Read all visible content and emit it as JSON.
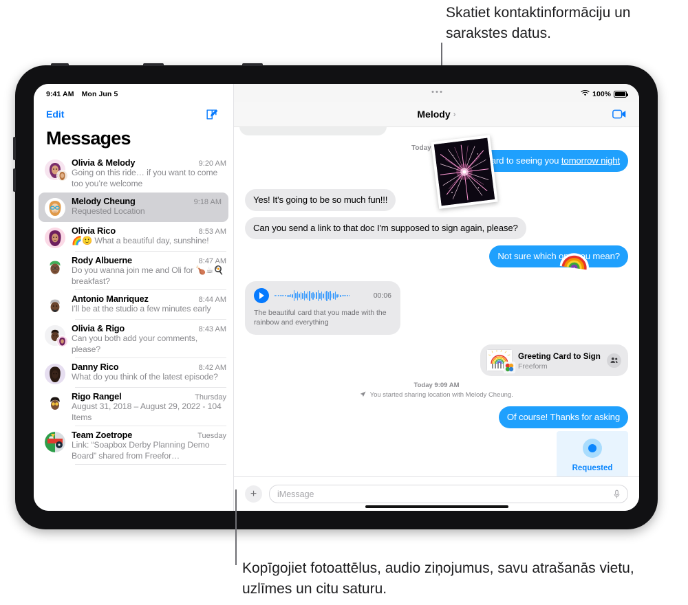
{
  "callouts": {
    "top": "Skatiet kontaktinformāciju un sarakstes datus.",
    "bottom": "Kopīgojiet fotoattēlus, audio ziņojumus, savu atrašanās vietu, uzlīmes un citu saturu."
  },
  "status_bar": {
    "time": "9:41 AM",
    "date": "Mon Jun 5",
    "battery_percent": "100%",
    "wifi_icon": "wifi-icon",
    "battery_icon": "battery-icon"
  },
  "sidebar": {
    "edit_label": "Edit",
    "compose_icon": "compose-icon",
    "title": "Messages",
    "conversations": [
      {
        "name": "Olivia & Melody",
        "time": "9:20 AM",
        "preview": "Going on this ride… if you want to come too you’re welcome",
        "selected": false,
        "avatar": "group-avatar-olivia-melody"
      },
      {
        "name": "Melody Cheung",
        "time": "9:18 AM",
        "preview": "Requested Location",
        "selected": true,
        "avatar": "avatar-melody-cheung"
      },
      {
        "name": "Olivia Rico",
        "time": "8:53 AM",
        "preview": "🌈🙂 What a beautiful day, sunshine!",
        "selected": false,
        "avatar": "avatar-olivia-rico"
      },
      {
        "name": "Rody Albuerne",
        "time": "8:47 AM",
        "preview": "Do you wanna join me and Oli for 🍗☕🍳 breakfast?",
        "selected": false,
        "avatar": "avatar-rody-albuerne"
      },
      {
        "name": "Antonio Manriquez",
        "time": "8:44 AM",
        "preview": "I’ll be at the studio a few minutes early",
        "selected": false,
        "avatar": "avatar-antonio-manriquez"
      },
      {
        "name": "Olivia & Rigo",
        "time": "8:43 AM",
        "preview": "Can you both add your comments, please?",
        "selected": false,
        "avatar": "group-avatar-olivia-rigo"
      },
      {
        "name": "Danny Rico",
        "time": "8:42 AM",
        "preview": "What do you think of the latest episode?",
        "selected": false,
        "avatar": "avatar-danny-rico"
      },
      {
        "name": "Rigo Rangel",
        "time": "Thursday",
        "preview": "August 31, 2018 – August 29, 2022 - 104 Items",
        "selected": false,
        "avatar": "avatar-rigo-rangel"
      },
      {
        "name": "Team Zoetrope",
        "time": "Tuesday",
        "preview": "Link: “Soapbox Derby Planning Demo Board” shared from Freefor…",
        "selected": false,
        "avatar": "group-avatar-team-zoetrope"
      }
    ]
  },
  "chat": {
    "title": "Melody",
    "chevron_icon": "chevron-right-icon",
    "facetime_icon": "facetime-video-icon",
    "daystamp": "Today",
    "messages": [
      {
        "kind": "out-text",
        "text": "…ard to seeing you ",
        "link": "tomorrow night"
      },
      {
        "kind": "in-text",
        "text": "Yes! It's going to be so much fun!!!"
      },
      {
        "kind": "in-text",
        "text": "Can you send a link to that doc I'm supposed to sign again, please?"
      },
      {
        "kind": "out-text",
        "text": "Not sure which one you mean?"
      }
    ],
    "audio_message": {
      "duration": "00:06",
      "transcript": "The beautiful card that you made with the rainbow and everything",
      "play_icon": "play-icon"
    },
    "shared_card": {
      "title": "Greeting Card to Sign",
      "app": "Freeform",
      "collab_icon": "people-icon"
    },
    "system_message": {
      "timestamp": "Today 9:09 AM",
      "text": "You started sharing location with Melody Cheung.",
      "icon": "location-arrow-icon"
    },
    "last_out_message": "Of course! Thanks for asking",
    "location_tile": {
      "label": "Requested",
      "icon": "location-dot-icon"
    },
    "composer": {
      "plus_icon": "plus-icon",
      "placeholder": "iMessage",
      "value": "",
      "mic_icon": "microphone-icon"
    }
  },
  "colors": {
    "accent_blue": "#067afe",
    "bubble_out": "#1fa0fd",
    "bubble_in": "#e9e9eb",
    "selected_row": "#d2d2d6",
    "location_tile_bg": "#e8f4fe"
  }
}
